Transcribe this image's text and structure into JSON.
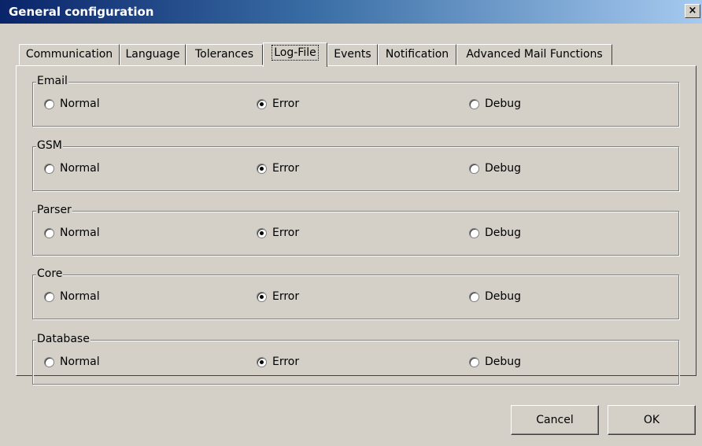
{
  "window": {
    "title": "General configuration",
    "close_label": "×"
  },
  "tabs": [
    {
      "label": "Communication",
      "active": false
    },
    {
      "label": "Language",
      "active": false
    },
    {
      "label": "Tolerances",
      "active": false
    },
    {
      "label": "Log-File",
      "active": true
    },
    {
      "label": "Events",
      "active": false
    },
    {
      "label": "Notification",
      "active": false
    },
    {
      "label": "Advanced Mail Functions",
      "active": false
    }
  ],
  "groups": [
    {
      "label": "Email",
      "options": [
        "Normal",
        "Error",
        "Debug"
      ],
      "selected": "Error"
    },
    {
      "label": "GSM",
      "options": [
        "Normal",
        "Error",
        "Debug"
      ],
      "selected": "Error"
    },
    {
      "label": "Parser",
      "options": [
        "Normal",
        "Error",
        "Debug"
      ],
      "selected": "Error"
    },
    {
      "label": "Core",
      "options": [
        "Normal",
        "Error",
        "Debug"
      ],
      "selected": "Error"
    },
    {
      "label": "Database",
      "options": [
        "Normal",
        "Error",
        "Debug"
      ],
      "selected": "Error"
    }
  ],
  "buttons": {
    "cancel_label": "Cancel",
    "ok_label": "OK"
  }
}
